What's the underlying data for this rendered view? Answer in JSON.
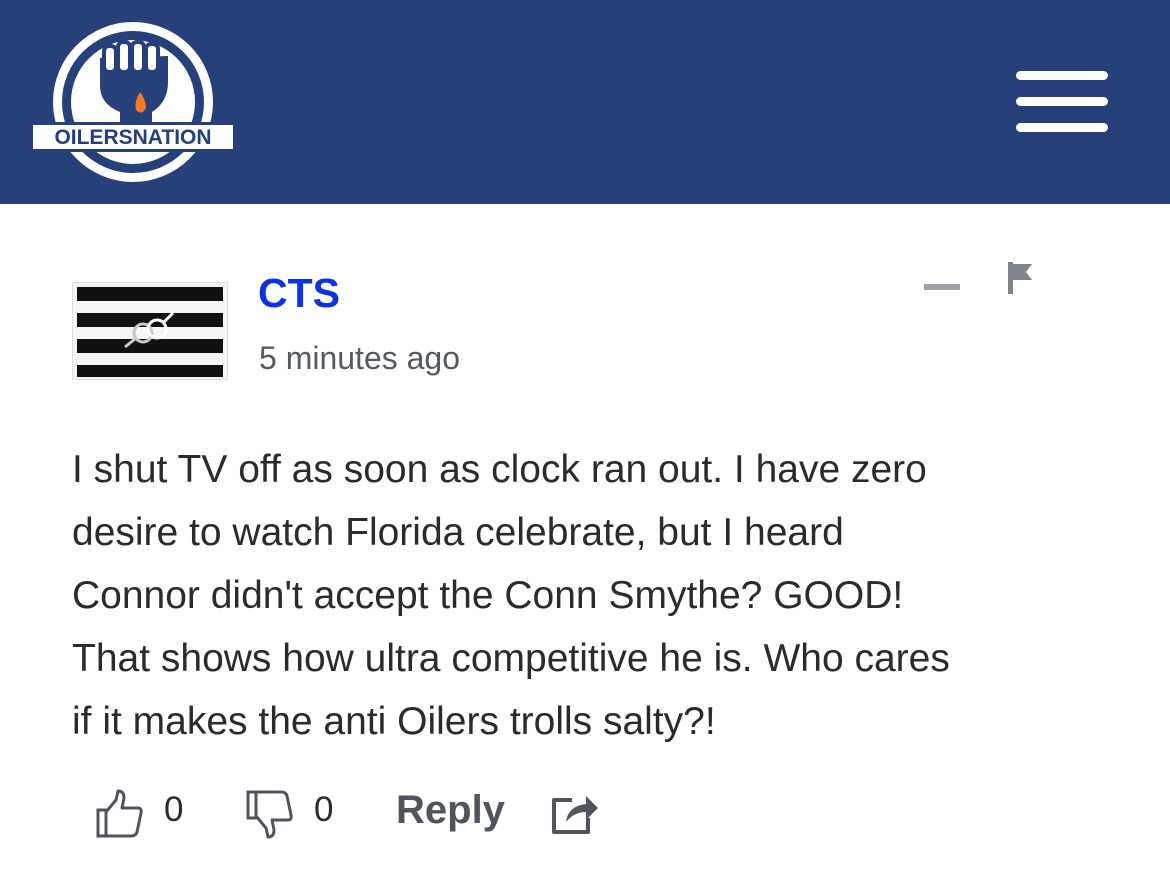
{
  "header": {
    "logo_text": "OILERSNATION",
    "background_color": "#26407a",
    "menu_icon": "hamburger-menu-icon"
  },
  "comment": {
    "author": "CTS",
    "author_color": "#0b33e0",
    "timestamp": "5 minutes ago",
    "body_lines": [
      "I shut TV off as soon as clock ran out. I have zero",
      "desire to watch Florida celebrate, but I heard",
      "Connor didn't accept the Conn Smythe? GOOD!",
      "That shows how ultra competitive he is. Who cares",
      "if it makes the anti Oilers trolls salty?!"
    ],
    "collapse_icon": "minus-icon",
    "flag_icon": "flag-icon"
  },
  "actions": {
    "upvote_icon": "thumbs-up-icon",
    "upvote_count": "0",
    "downvote_icon": "thumbs-down-icon",
    "downvote_count": "0",
    "reply_label": "Reply",
    "share_icon": "share-icon"
  }
}
